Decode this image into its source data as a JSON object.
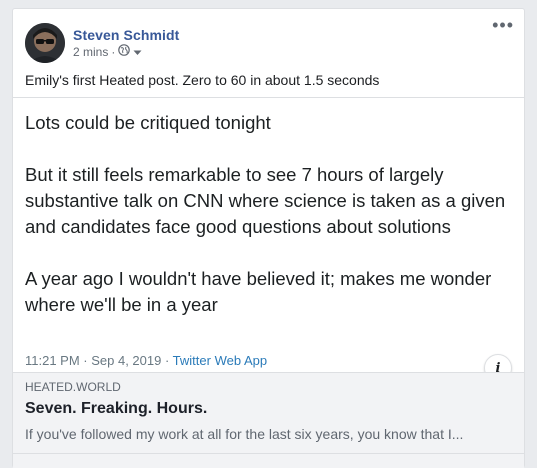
{
  "post": {
    "author": "Steven Schmidt",
    "time": "2 mins",
    "dot": "·",
    "caption": "Emily's first Heated post. Zero to 60 in about 1.5 seconds",
    "more_label": "•••"
  },
  "tweet": {
    "paragraphs": [
      "Lots could be critiqued tonight",
      "But it still feels remarkable to see 7 hours of largely substantive talk on CNN where science is taken as a given and candidates face good questions about solutions",
      "A year ago I wouldn't have believed it; makes me wonder where we'll be in a year"
    ],
    "timestamp": "11:21 PM · Sep 4, 2019 · ",
    "app": "Twitter Web App",
    "info_label": "i"
  },
  "link": {
    "domain": "HEATED.WORLD",
    "title": "Seven. Freaking. Hours.",
    "description": "If you've followed my work at all for the last six years, you know that I..."
  }
}
